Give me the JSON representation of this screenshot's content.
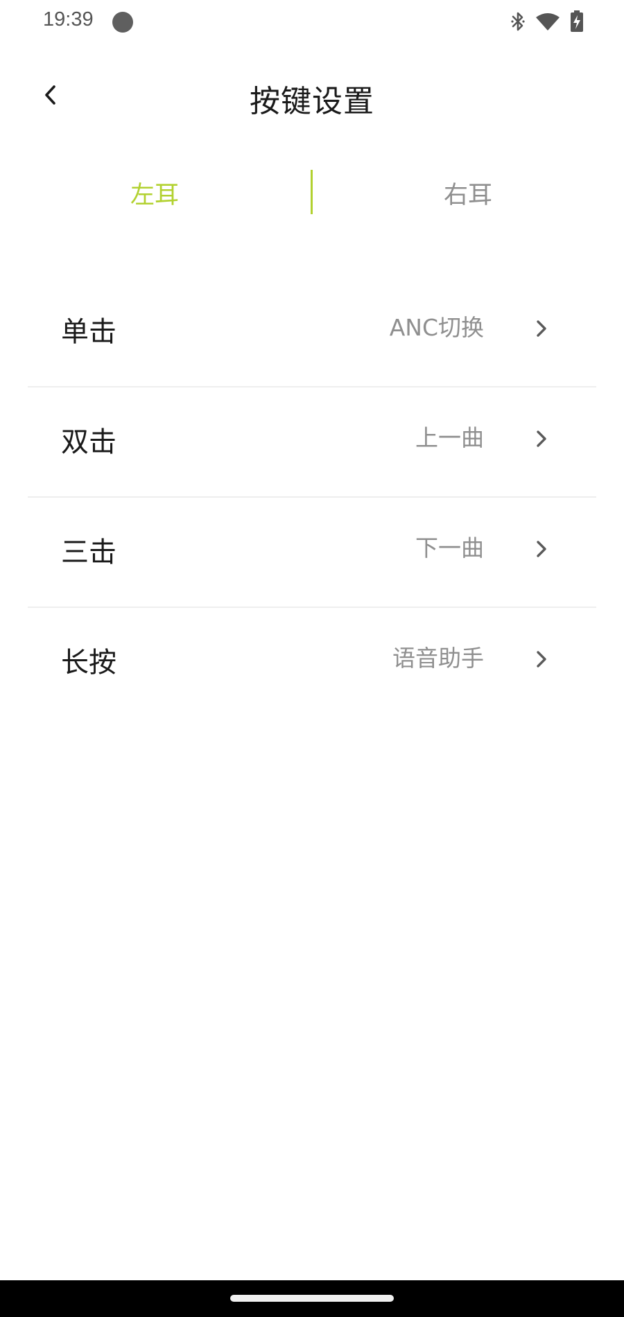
{
  "status_bar": {
    "time": "19:39",
    "icons": [
      "bluetooth-icon",
      "wifi-icon",
      "battery-charging-icon"
    ]
  },
  "header": {
    "title": "按键设置"
  },
  "ear_tabs": {
    "left": "左耳",
    "right": "右耳",
    "selected": "left",
    "accent_color": "#b2d130"
  },
  "settings": [
    {
      "label": "单击",
      "value": "ANC切换"
    },
    {
      "label": "双击",
      "value": "上一曲"
    },
    {
      "label": "三击",
      "value": "下一曲"
    },
    {
      "label": "长按",
      "value": "语音助手"
    }
  ]
}
